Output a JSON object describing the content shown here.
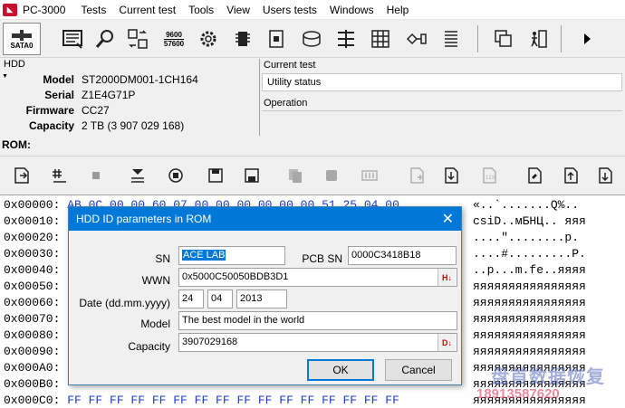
{
  "app": {
    "title": "PC-3000"
  },
  "menu": [
    "Tests",
    "Current test",
    "Tools",
    "View",
    "Users tests",
    "Windows",
    "Help"
  ],
  "toolbar": {
    "sata_label": "SATA0",
    "speed_top": "9600",
    "speed_bottom": "57600"
  },
  "hdd": {
    "title": "HDD",
    "rows": [
      {
        "key": "Model",
        "value": "ST2000DM001-1CH164"
      },
      {
        "key": "Serial",
        "value": "Z1E4G71P"
      },
      {
        "key": "Firmware",
        "value": "CC27"
      },
      {
        "key": "Capacity",
        "value": "2 TB (3 907 029 168)"
      }
    ]
  },
  "current_test": {
    "title": "Current test",
    "status": "Utility status",
    "operation_title": "Operation"
  },
  "rom": {
    "label": "ROM:"
  },
  "hex": [
    {
      "addr": "0x00000:",
      "bytes": " AB 0C 00 00 60 07 00 00 00 00 00 00 51 25 04 00",
      "ascii": "«..`.......Q%.."
    },
    {
      "addr": "0x00010:",
      "bytes": "",
      "ascii": "csiD..мБНЦ.. яяя"
    },
    {
      "addr": "0x00020:",
      "bytes": "",
      "ascii": "....\"........p."
    },
    {
      "addr": "0x00030:",
      "bytes": "",
      "ascii": "....#.........P."
    },
    {
      "addr": "0x00040:",
      "bytes": "",
      "ascii": "..p...m.fe..яяяя"
    },
    {
      "addr": "0x00050:",
      "bytes": "",
      "ascii": "яяяяяяяяяяяяяяяя"
    },
    {
      "addr": "0x00060:",
      "bytes": "",
      "ascii": "яяяяяяяяяяяяяяяя"
    },
    {
      "addr": "0x00070:",
      "bytes": "",
      "ascii": "яяяяяяяяяяяяяяяя"
    },
    {
      "addr": "0x00080:",
      "bytes": "",
      "ascii": "яяяяяяяяяяяяяяяя"
    },
    {
      "addr": "0x00090:",
      "bytes": "",
      "ascii": "яяяяяяяяяяяяяяяя"
    },
    {
      "addr": "0x000A0:",
      "bytes": "",
      "ascii": "яяяяяяяяяяяяяяяя"
    },
    {
      "addr": "0x000B0:",
      "bytes": "",
      "ascii": "яяяяяяяяяяяяяяяя"
    },
    {
      "addr": "0x000C0:",
      "bytes": " FF FF FF FF FF FF FF FF FF FF FF FF FF FF FF FF",
      "ascii": "яяяяяяяяяяяяяяяя"
    }
  ],
  "dialog": {
    "title": "HDD ID parameters in ROM",
    "sn_label": "SN",
    "sn_value": "ACE LAB",
    "pcb_sn_label": "PCB SN",
    "pcb_sn_value": "0000C3418B18",
    "wwn_label": "WWN",
    "wwn_value": "0x5000C50050BDB3D1",
    "date_label": "Date (dd.mm.yyyy)",
    "date_day": "24",
    "date_month": "04",
    "date_year": "2013",
    "model_label": "Model",
    "model_value": "The best model in the world",
    "capacity_label": "Capacity",
    "capacity_value": "3907029168",
    "ok": "OK",
    "cancel": "Cancel"
  },
  "watermark": {
    "line1": "盘首数据恢复",
    "line2": "18913587620"
  },
  "colors": {
    "accent": "#0078d7",
    "hex_bytes": "#1a3cc8"
  }
}
